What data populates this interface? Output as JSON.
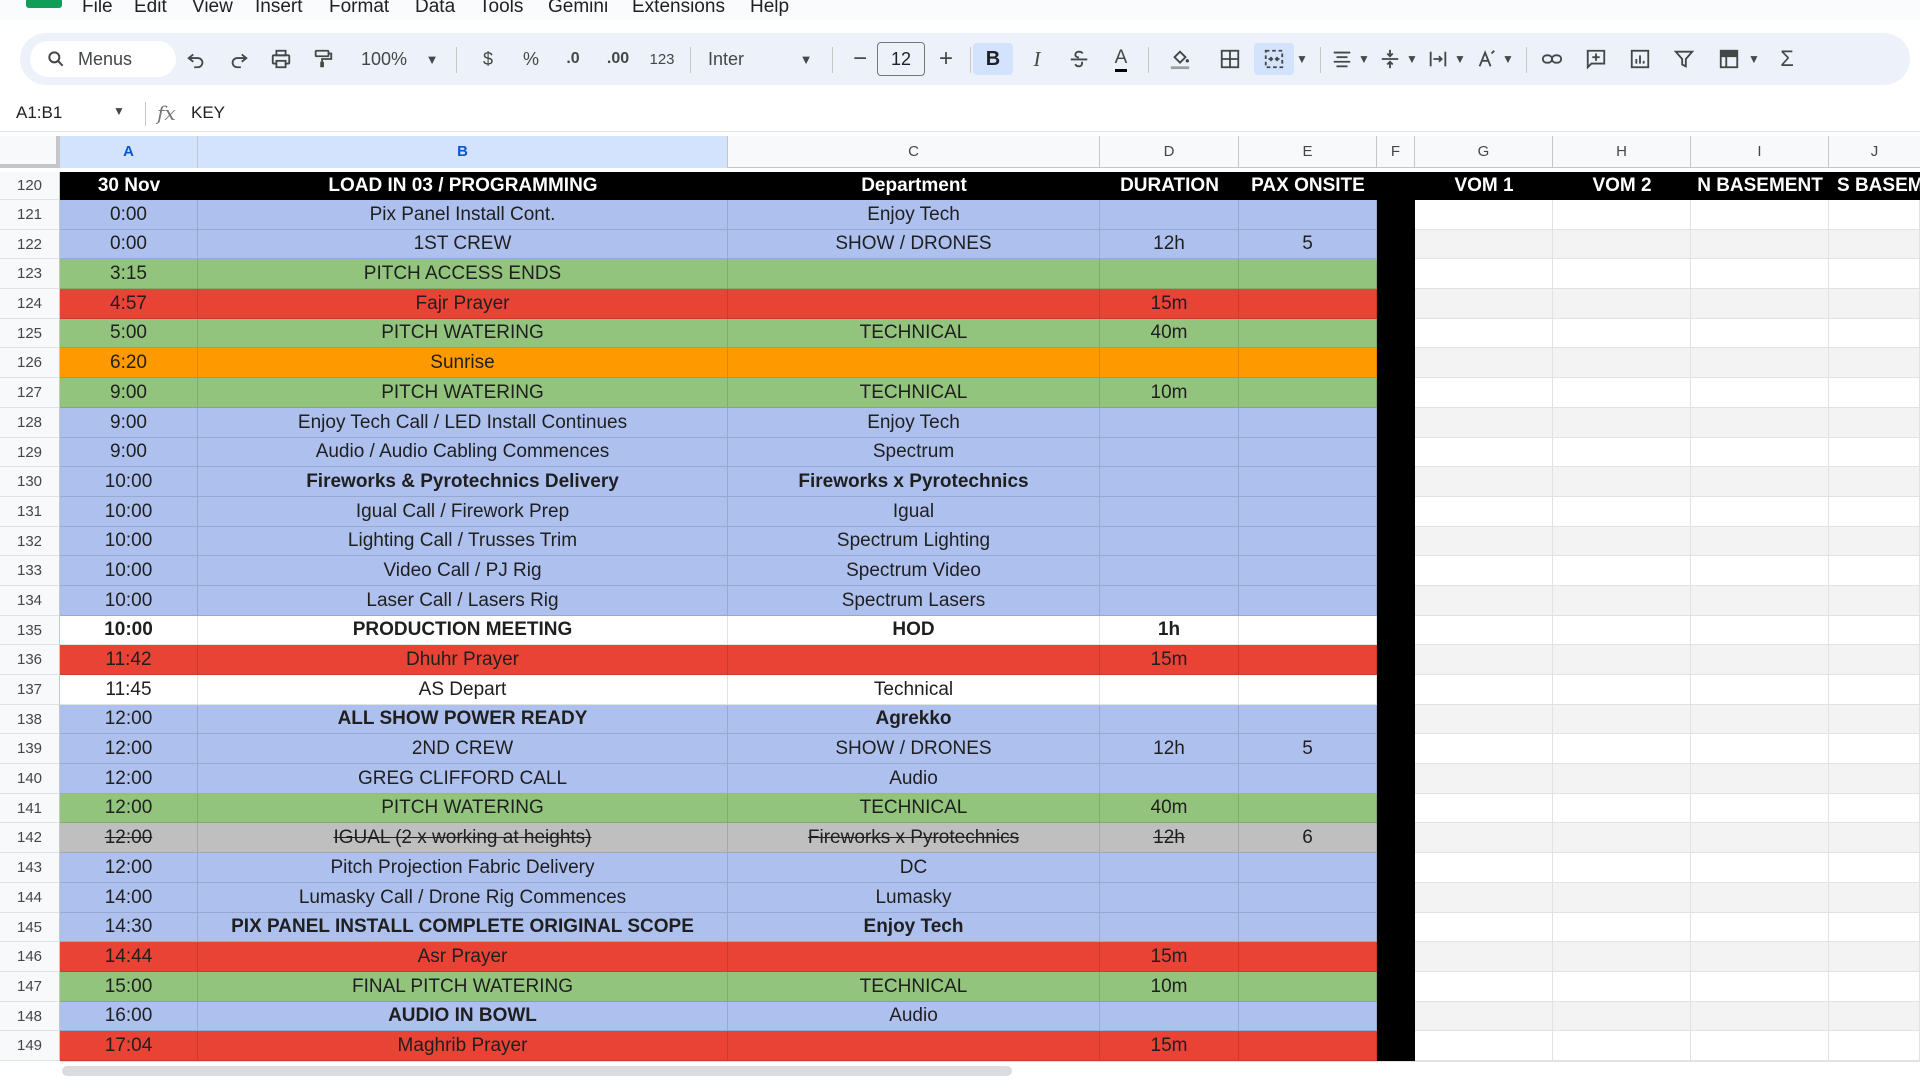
{
  "menu": [
    "File",
    "Edit",
    "View",
    "Insert",
    "Format",
    "Data",
    "Tools",
    "Gemini",
    "Extensions",
    "Help"
  ],
  "toolbar": {
    "search_label": "Menus",
    "zoom": "100%",
    "currency": "$",
    "percent": "%",
    "decrease_decimal": ".0",
    "increase_decimal": ".00",
    "number_format": "123",
    "font": "Inter",
    "font_size": "12",
    "minus": "−",
    "plus": "+",
    "bold": "B",
    "italic": "I",
    "text_color": "A"
  },
  "formula_bar": {
    "name_box": "A1:B1",
    "fx": "fx",
    "formula": "KEY"
  },
  "colors": {
    "blue": "#aec0ee",
    "green": "#93c47d",
    "red": "#e94335",
    "orange": "#ff9900",
    "grey": "#bfbfbf",
    "white": "#ffffff",
    "black": "#000000"
  },
  "columns": [
    "A",
    "B",
    "C",
    "D",
    "E",
    "F",
    "G",
    "H",
    "I",
    "J"
  ],
  "header_row": {
    "num": "120",
    "a": "30 Nov",
    "b": "LOAD IN 03 / PROGRAMMING",
    "c": "Department",
    "d": "DURATION",
    "e": "PAX ONSITE",
    "g": "VOM 1",
    "h": "VOM 2",
    "i": "N BASEMENT",
    "j": "S BASEM"
  },
  "rows": [
    {
      "num": "121",
      "a": "0:00",
      "b": "Pix Panel Install Cont.",
      "c": "Enjoy Tech",
      "d": "",
      "e": "",
      "color": "blue"
    },
    {
      "num": "122",
      "a": "0:00",
      "b": "1ST CREW",
      "c": "SHOW / DRONES",
      "d": "12h",
      "e": "5",
      "color": "blue"
    },
    {
      "num": "123",
      "a": "3:15",
      "b": "PITCH ACCESS ENDS",
      "c": "",
      "d": "",
      "e": "",
      "color": "green"
    },
    {
      "num": "124",
      "a": "4:57",
      "b": "Fajr Prayer",
      "c": "",
      "d": "15m",
      "e": "",
      "color": "red"
    },
    {
      "num": "125",
      "a": "5:00",
      "b": "PITCH WATERING",
      "c": "TECHNICAL",
      "d": "40m",
      "e": "",
      "color": "green"
    },
    {
      "num": "126",
      "a": "6:20",
      "b": "Sunrise",
      "c": "",
      "d": "",
      "e": "",
      "color": "orange"
    },
    {
      "num": "127",
      "a": "9:00",
      "b": "PITCH WATERING",
      "c": "TECHNICAL",
      "d": "10m",
      "e": "",
      "color": "green"
    },
    {
      "num": "128",
      "a": "9:00",
      "b": "Enjoy Tech Call / LED Install Continues",
      "c": "Enjoy Tech",
      "d": "",
      "e": "",
      "color": "blue"
    },
    {
      "num": "129",
      "a": "9:00",
      "b": "Audio / Audio Cabling Commences",
      "c": "Spectrum",
      "d": "",
      "e": "",
      "color": "blue"
    },
    {
      "num": "130",
      "a": "10:00",
      "b": "Fireworks & Pyrotechnics Delivery",
      "c": "Fireworks x Pyrotechnics",
      "d": "",
      "e": "",
      "color": "blue",
      "bold_bc": true
    },
    {
      "num": "131",
      "a": "10:00",
      "b": "Igual Call / Firework Prep",
      "c": "Igual",
      "d": "",
      "e": "",
      "color": "blue"
    },
    {
      "num": "132",
      "a": "10:00",
      "b": "Lighting Call / Trusses Trim",
      "c": "Spectrum Lighting",
      "d": "",
      "e": "",
      "color": "blue"
    },
    {
      "num": "133",
      "a": "10:00",
      "b": "Video Call / PJ Rig",
      "c": "Spectrum Video",
      "d": "",
      "e": "",
      "color": "blue"
    },
    {
      "num": "134",
      "a": "10:00",
      "b": "Laser Call / Lasers Rig",
      "c": "Spectrum Lasers",
      "d": "",
      "e": "",
      "color": "blue"
    },
    {
      "num": "135",
      "a": "10:00",
      "b": "PRODUCTION MEETING",
      "c": "HOD",
      "d": "1h",
      "e": "",
      "color": "white",
      "bold_all": true
    },
    {
      "num": "136",
      "a": "11:42",
      "b": "Dhuhr Prayer",
      "c": "",
      "d": "15m",
      "e": "",
      "color": "red"
    },
    {
      "num": "137",
      "a": "11:45",
      "b": "AS Depart",
      "c": "Technical",
      "d": "",
      "e": "",
      "color": "white"
    },
    {
      "num": "138",
      "a": "12:00",
      "b": "ALL SHOW POWER READY",
      "c": "Agrekko",
      "d": "",
      "e": "",
      "color": "blue",
      "bold_bc": true
    },
    {
      "num": "139",
      "a": "12:00",
      "b": "2ND CREW",
      "c": "SHOW / DRONES",
      "d": "12h",
      "e": "5",
      "color": "blue"
    },
    {
      "num": "140",
      "a": "12:00",
      "b": "GREG CLIFFORD CALL",
      "c": "Audio",
      "d": "",
      "e": "",
      "color": "blue"
    },
    {
      "num": "141",
      "a": "12:00",
      "b": "PITCH WATERING",
      "c": "TECHNICAL",
      "d": "40m",
      "e": "",
      "color": "green"
    },
    {
      "num": "142",
      "a": "12:00",
      "b": "IGUAL (2 x working at heights)",
      "c": "Fireworks x Pyrotechnics",
      "d": "12h",
      "e": "6",
      "color": "grey",
      "strike": true
    },
    {
      "num": "143",
      "a": "12:00",
      "b": "Pitch Projection Fabric Delivery",
      "c": "DC",
      "d": "",
      "e": "",
      "color": "blue"
    },
    {
      "num": "144",
      "a": "14:00",
      "b": "Lumasky Call / Drone Rig Commences",
      "c": "Lumasky",
      "d": "",
      "e": "",
      "color": "blue"
    },
    {
      "num": "145",
      "a": "14:30",
      "b": "PIX PANEL INSTALL COMPLETE ORIGINAL SCOPE",
      "c": "Enjoy Tech",
      "d": "",
      "e": "",
      "color": "blue",
      "bold_bc": true
    },
    {
      "num": "146",
      "a": "14:44",
      "b": "Asr Prayer",
      "c": "",
      "d": "15m",
      "e": "",
      "color": "red"
    },
    {
      "num": "147",
      "a": "15:00",
      "b": "FINAL PITCH WATERING",
      "c": "TECHNICAL",
      "d": "10m",
      "e": "",
      "color": "green"
    },
    {
      "num": "148",
      "a": "16:00",
      "b": "AUDIO IN BOWL",
      "c": "Audio",
      "d": "",
      "e": "",
      "color": "blue",
      "bold_b": true
    },
    {
      "num": "149",
      "a": "17:04",
      "b": "Maghrib Prayer",
      "c": "",
      "d": "15m",
      "e": "",
      "color": "red"
    }
  ]
}
